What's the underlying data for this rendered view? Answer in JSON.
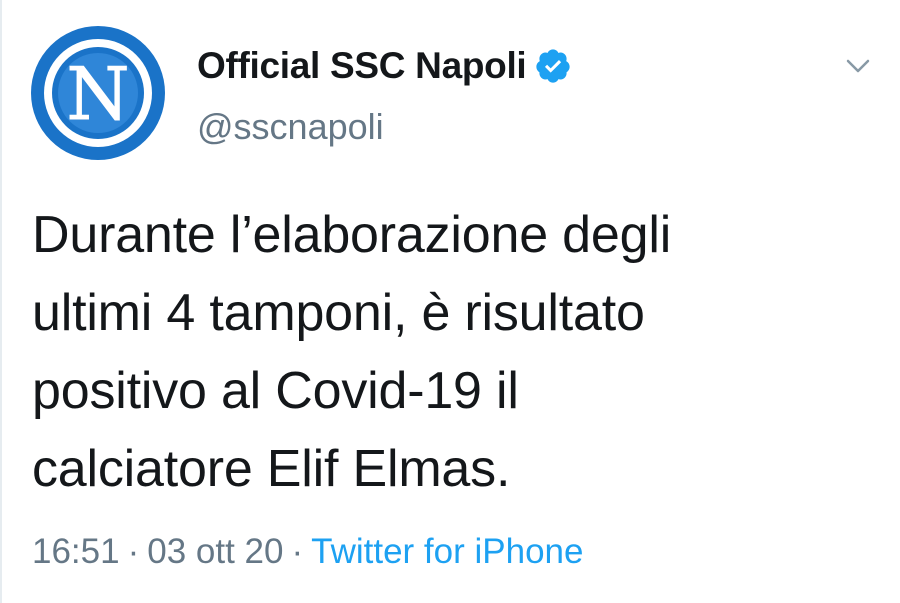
{
  "tweet": {
    "display_name": "Official SSC Napoli",
    "handle": "@sscnapoli",
    "avatar_letter": "N",
    "verified": true,
    "text_lines": [
      "Durante l’elaborazione degli",
      "ultimi 4 tamponi, è risultato",
      "positivo al Covid-19 il",
      "calciatore Elif Elmas."
    ],
    "time": "16:51",
    "date": "03 ott 20",
    "separator": "·",
    "source": "Twitter for iPhone"
  },
  "colors": {
    "text": "#14171a",
    "secondary": "#657786",
    "link": "#1da1f2",
    "verified": "#1da1f2",
    "avatar_blue": "#1a73c8"
  },
  "icons": {
    "verified": "verified-badge-icon",
    "menu": "chevron-down-icon"
  }
}
